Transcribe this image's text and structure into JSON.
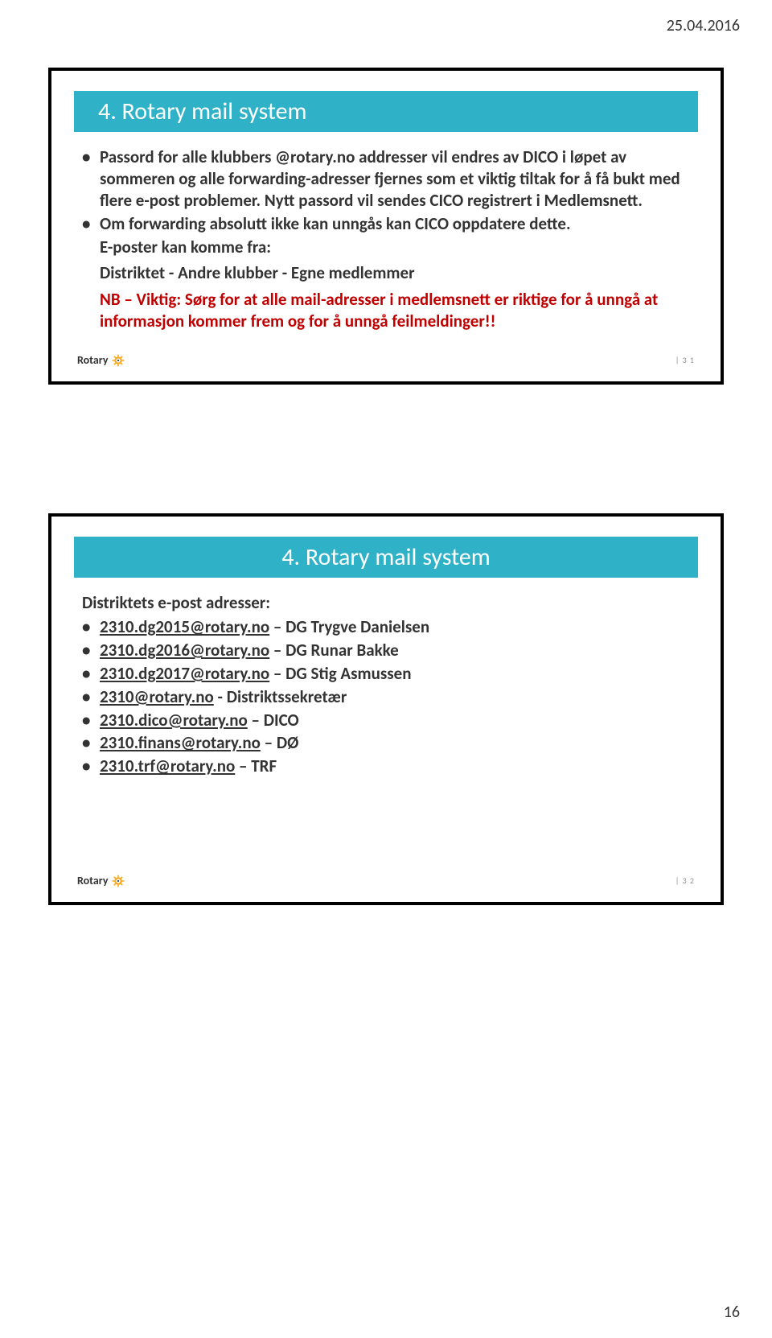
{
  "header_date": "25.04.2016",
  "footer_page": "16",
  "slide31": {
    "title": "4. Rotary mail system",
    "bullets": [
      "Passord for alle klubbers @rotary.no addresser vil endres av DICO i løpet av sommeren og alle forwarding-adresser fjernes som et viktig tiltak for å få bukt med flere e-post problemer. Nytt passord vil sendes CICO registrert i Medlemsnett.",
      "Om forwarding absolutt ikke kan unngås kan CICO oppdatere dette."
    ],
    "para1": "E-poster kan komme fra:",
    "para2": "Distriktet - Andre klubber - Egne medlemmer",
    "highlight": "NB – Viktig: Sørg for at alle mail-adresser i medlemsnett er riktige for å unngå at informasjon kommer frem og for å unngå feilmeldinger!!",
    "logo_text": "Rotary",
    "page_label": "| 3 1"
  },
  "slide32": {
    "title": "4. Rotary mail system",
    "subheading": "Distriktets e-post adresser:",
    "items": [
      {
        "email": "2310.dg2015@rotary.no",
        "rest": " – DG Trygve Danielsen"
      },
      {
        "email": "2310.dg2016@rotary.no",
        "rest": " – DG Runar Bakke"
      },
      {
        "email": "2310.dg2017@rotary.no",
        "rest": " – DG Stig Asmussen"
      },
      {
        "email": "2310@rotary.no",
        "rest": " - Distriktssekretær"
      },
      {
        "email": "2310.dico@rotary.no",
        "rest": " – DICO"
      },
      {
        "email": "2310.finans@rotary.no",
        "rest": " – DØ"
      },
      {
        "email": "2310.trf@rotary.no",
        "rest": " – TRF"
      }
    ],
    "logo_text": "Rotary",
    "page_label": "| 3 2"
  }
}
